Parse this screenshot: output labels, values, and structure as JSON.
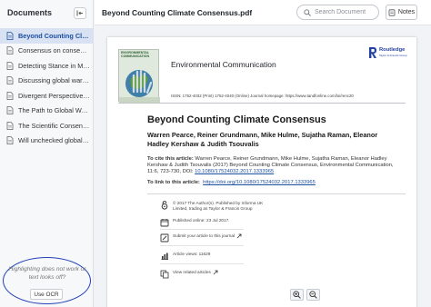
{
  "sidebar": {
    "title": "Documents",
    "items": [
      {
        "label": "Beyond Counting Climate Consensus.pdf",
        "active": true
      },
      {
        "label": "Consensus on consensus.pdf",
        "active": false
      },
      {
        "label": "Detecting Stance in Media.pdf",
        "active": false
      },
      {
        "label": "Discussing global warming.pdf",
        "active": false
      },
      {
        "label": "Divergent Perspectives.pdf",
        "active": false
      },
      {
        "label": "The Path to Global Warming.pdf",
        "active": false
      },
      {
        "label": "The Scientific Consensus.pdf",
        "active": false
      },
      {
        "label": "Will unchecked global warming.pdf",
        "active": false
      }
    ],
    "ocr_hint": "Highlighting does not work or text looks off?",
    "ocr_button": "Use OCR"
  },
  "header": {
    "doc_title": "Beyond Counting Climate Consensus.pdf",
    "search_placeholder": "Search Document",
    "notes_label": "Notes"
  },
  "page": {
    "cover_title": "ENVIRONMENTAL COMMUNICATION",
    "journal_name": "Environmental Communication",
    "publisher": "Routledge",
    "publisher_sub": "Taylor & Francis Group",
    "issn": "ISSN: 1752-4032 (Print) 1752-4040 (Online) Journal homepage: https://www.tandfonline.com/loi/renc20",
    "article_title": "Beyond Counting Climate Consensus",
    "authors": "Warren Pearce, Reiner Grundmann, Mike Hulme, Sujatha Raman, Eleanor Hadley Kershaw & Judith Tsouvalis",
    "cite_label": "To cite this article:",
    "cite_text": " Warren Pearce, Reiner Grundmann, Mike Hulme, Sujatha Raman, Eleanor Hadley Kershaw & Judith Tsouvalis (2017) Beyond Counting Climate Consensus, Environmental Communication, 11:6, 723-730, DOI: ",
    "cite_doi": "10.1080/17524032.2017.1333965",
    "link_label": "To link to this article:",
    "link_url": "https://doi.org/10.1080/17524032.2017.1333965",
    "meta": [
      {
        "icon": "open-access-icon",
        "text": "© 2017 The Author(s). Published by Informa UK Limited, trading as Taylor & Francis Group"
      },
      {
        "icon": "calendar-icon",
        "text": "Published online: 23 Jul 2017."
      },
      {
        "icon": "edit-icon",
        "text": "Submit your article to this journal"
      },
      {
        "icon": "chart-icon",
        "text": "Article views: 11629"
      },
      {
        "icon": "related-icon",
        "text": "View related articles"
      }
    ]
  },
  "colors": {
    "accent": "#1b4fa0",
    "active_bg": "#d8e2f3",
    "ocr_circle": "#2340b8"
  }
}
